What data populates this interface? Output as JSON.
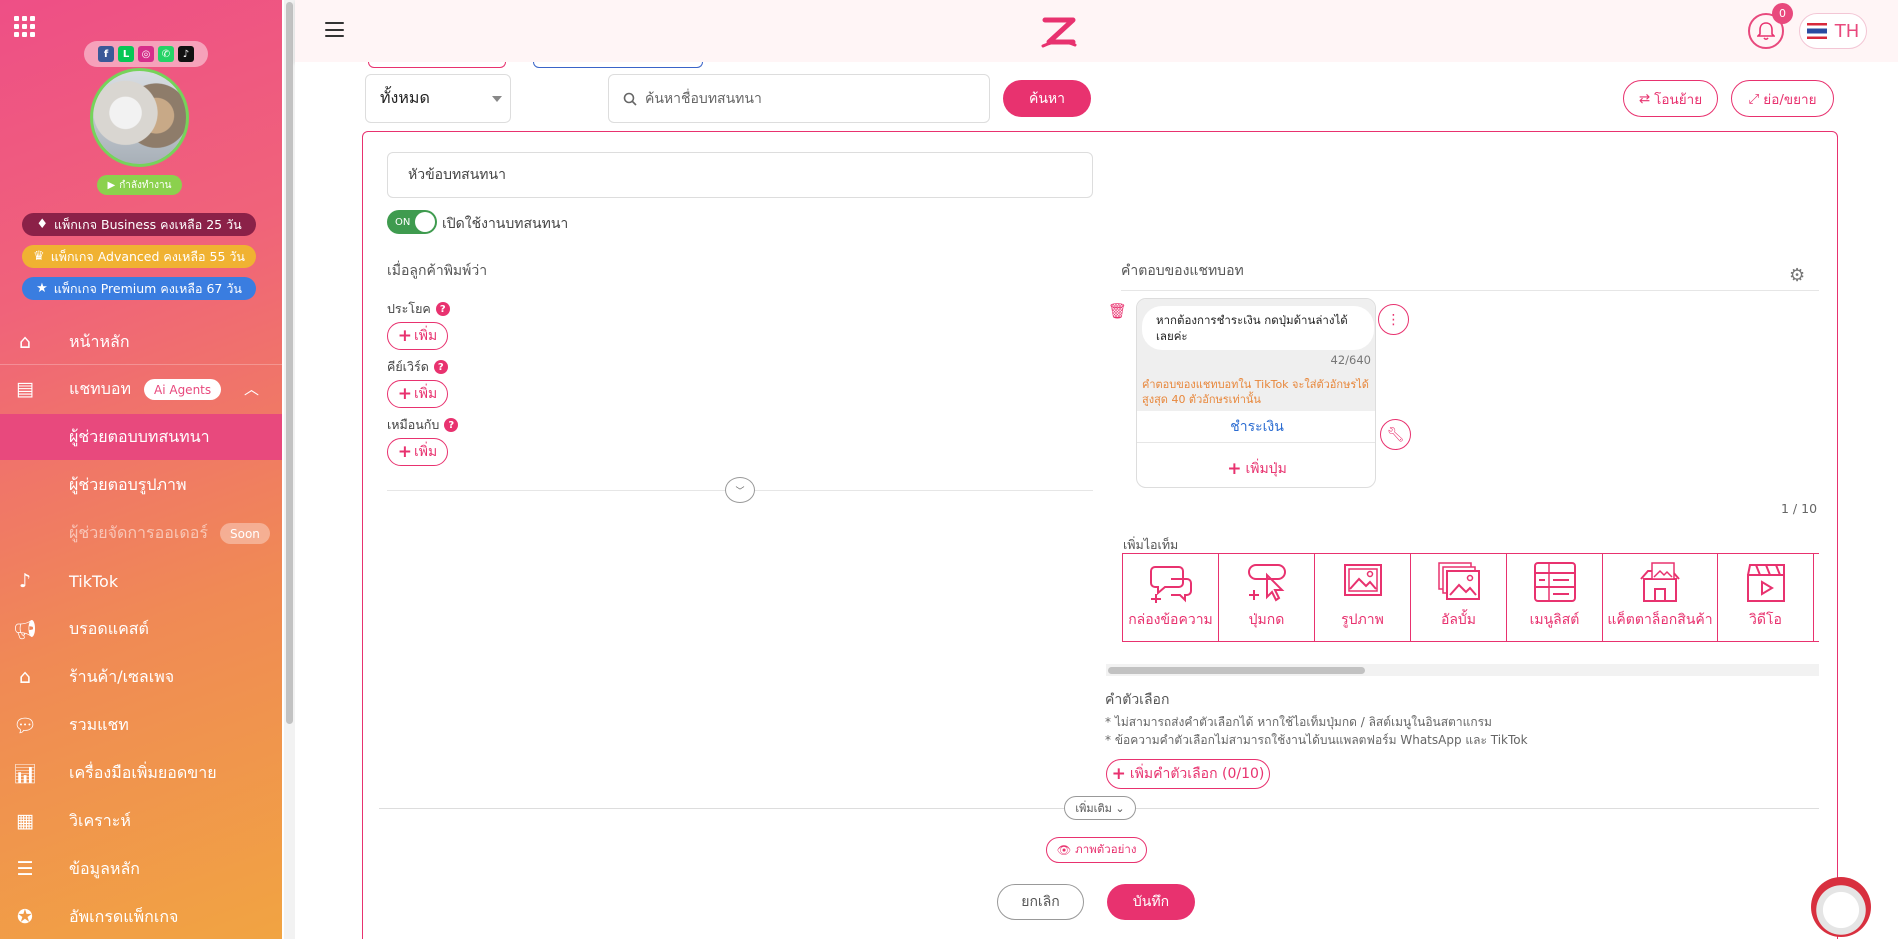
{
  "colors": {
    "brand": "#e8326f",
    "sidebar_start": "#ee4f86",
    "sidebar_end": "#f1a442",
    "toggle_on": "#3f9b4f"
  },
  "sidebar": {
    "grid_icon": "apps-grid-icon",
    "socials": [
      "facebook",
      "line",
      "instagram",
      "whatsapp",
      "tiktok"
    ],
    "status_label": "กำลังทำงาน",
    "packages": [
      {
        "label": "แพ็กเกจ Business คงเหลือ 25 วัน",
        "icon": "diamond-icon",
        "color": "#8b2148"
      },
      {
        "label": "แพ็กเกจ Advanced คงเหลือ 55 วัน",
        "icon": "crown-icon",
        "color": "#f0b232"
      },
      {
        "label": "แพ็กเกจ Premium คงเหลือ 67 วัน",
        "icon": "star-icon",
        "color": "#3a7de0"
      }
    ],
    "nav": {
      "home": "หน้าหลัก",
      "chatbot": "แชทบอท",
      "ai_badge": "Ai Agents",
      "chat_assistant": "ผู้ช่วยตอบบทสนทนา",
      "image_assistant": "ผู้ช่วยตอบรูปภาพ",
      "order_assistant": "ผู้ช่วยจัดการออเดอร์",
      "soon": "Soon",
      "tiktok": "TikTok",
      "broadcast": "บรอดแคสต์",
      "shop": "ร้านค้า/เซลเพจ",
      "all_chat": "รวมแชท",
      "sales_tools": "เครื่องมือเพิ่มยอดขาย",
      "analytics": "วิเคราะห์",
      "master_data": "ข้อมูลหลัก",
      "upgrade": "อัพเกรดแพ็กเกจ"
    }
  },
  "header": {
    "notifications": "0",
    "language": "TH"
  },
  "toolbar": {
    "filter_value": "ทั้งหมด",
    "search_placeholder": "ค้นหาชื่อบทสนทนา",
    "search_button": "ค้นหา",
    "move_button": "โอนย้าย",
    "expand_button": "ย่อ/ขยาย"
  },
  "form": {
    "topic_placeholder": "หัวข้อบทสนทนา",
    "toggle_on": "ON",
    "toggle_label": "เปิดใช้งานบทสนทนา",
    "left_title": "เมื่อลูกค้าพิมพ์ว่า",
    "sentence_label": "ประโยค",
    "keyword_label": "คีย์เวิร์ด",
    "similar_label": "เหมือนกับ",
    "add_label": "เพิ่ม",
    "right_title": "คำตอบของแชทบอท",
    "message_text": "หากต้องการชำระเงิน กดปุ่มด้านล่างได้เลยค่ะ",
    "char_counter": "42/640",
    "tiktok_warning": "คำตอบของแชทบอทใน TikTok จะใส่ตัวอักษรได้สูงสุด 40 ตัวอักษรเท่านั้น",
    "pay_button": "ชำระเงิน",
    "add_button_label": "เพิ่มปุ่ม",
    "page_count": "1 / 10",
    "add_item_label": "เพิ่มไอเท็ม",
    "items": [
      "กล่องข้อความ",
      "ปุ่มกด",
      "รูปภาพ",
      "อัลบั้ม",
      "เมนูลิสต์",
      "แค็ตตาล็อกสินค้า",
      "วิดีโอ"
    ],
    "options_title": "คำตัวเลือก",
    "options_note1": "* ไม่สามารถส่งคำตัวเลือกได้ หากใช้ไอเท็มปุ่มกด / ลิสต์เมนูในอินสตาแกรม",
    "options_note2": "* ข้อความคำตัวเลือกไม่สามารถใช้งานได้บนแพลตฟอร์ม WhatsApp และ TikTok",
    "add_option_button": "เพิ่มคำตัวเลือก (0/10)",
    "more_button": "เพิ่มเติม",
    "preview_button": "ภาพตัวอย่าง",
    "cancel_button": "ยกเลิก",
    "save_button": "บันทึก"
  }
}
